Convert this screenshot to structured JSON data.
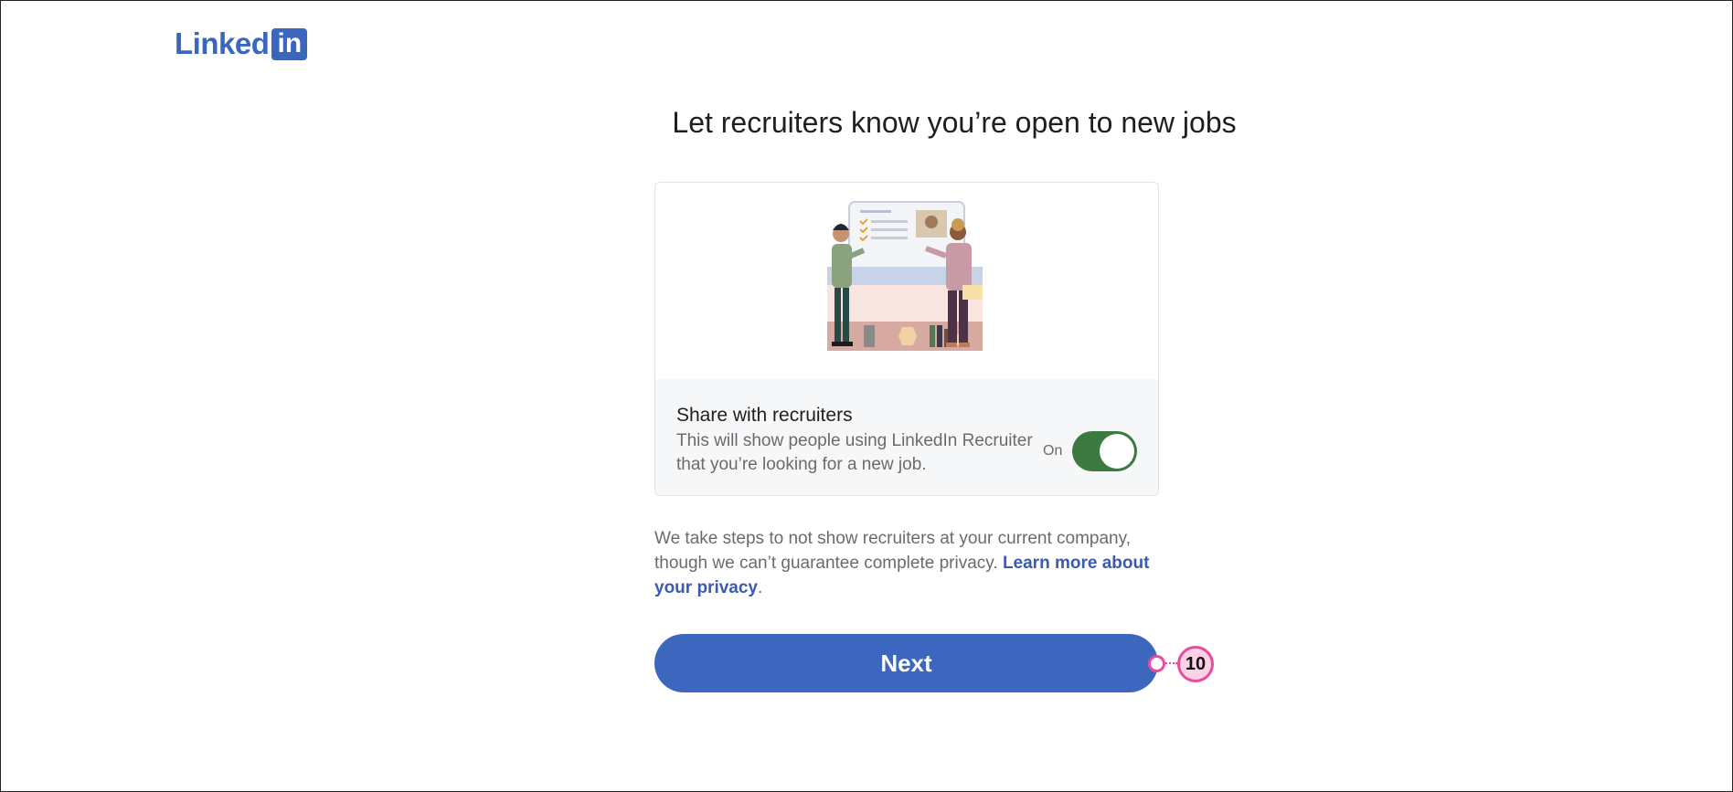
{
  "logo": {
    "word": "Linked",
    "box": "in"
  },
  "title": "Let recruiters know you’re open to new jobs",
  "card": {
    "illustration_icon": "recruiters-illustration",
    "share_title": "Share with recruiters",
    "share_desc": "This will show people using LinkedIn Recruiter that you’re looking for a new job.",
    "toggle_label": "On",
    "toggle_on": true
  },
  "privacy": {
    "text": "We take steps to not show recruiters at your current company, though we can’t guarantee complete privacy. ",
    "link": "Learn more about your privacy",
    "suffix": "."
  },
  "next_label": "Next",
  "marker": {
    "number": "10"
  },
  "colors": {
    "brand": "#3a66bd",
    "toggle_on": "#3c7a42",
    "marker": "#e94c9b"
  }
}
